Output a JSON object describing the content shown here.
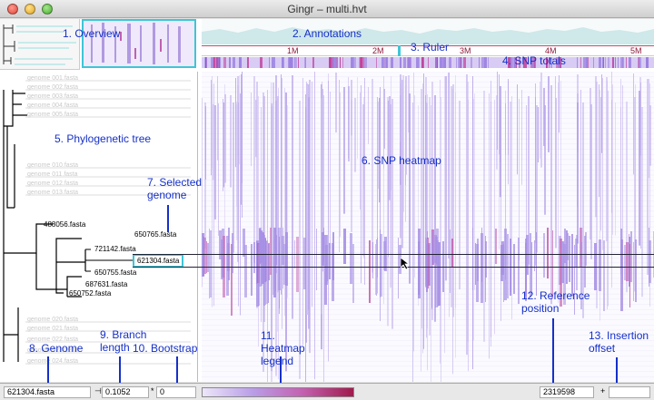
{
  "window": {
    "title": "Gingr – multi.hvt"
  },
  "ruler": {
    "ticks": [
      "1M",
      "2M",
      "3M",
      "4M",
      "5M"
    ]
  },
  "tree": {
    "genomes": [
      {
        "name": "488056.fasta"
      },
      {
        "name": "650765.fasta"
      },
      {
        "name": "721142.fasta"
      },
      {
        "name": "621304.fasta",
        "selected": true
      },
      {
        "name": "650755.fasta"
      },
      {
        "name": "687631.fasta"
      },
      {
        "name": "650752.fasta"
      }
    ]
  },
  "annotations_overlay": [
    {
      "label": "1. Overview"
    },
    {
      "label": "2. Annotations"
    },
    {
      "label": "3. Ruler"
    },
    {
      "label": "4. SNP totals"
    },
    {
      "label": "5. Phylogenetic tree"
    },
    {
      "label": "6. SNP heatmap"
    },
    {
      "label": "7. Selected genome"
    },
    {
      "label": "8. Genome"
    },
    {
      "label": "9. Branch length"
    },
    {
      "label": "10. Bootstrap"
    },
    {
      "label": "11. Heatmap legend"
    },
    {
      "label": "12. Reference position"
    },
    {
      "label": "13. Insertion offset"
    }
  ],
  "status": {
    "genome": "621304.fasta",
    "branch_icon": "⊣",
    "branch_length": "0.1052",
    "bootstrap_icon": "*",
    "bootstrap": "0",
    "reference_position": "2319598",
    "insertion_icon": "+",
    "insertion_offset": ""
  },
  "colors": {
    "accent": "#3ec6d6",
    "annotation_text": "#1530c8",
    "heat_low": "#ece6fa",
    "heat_mid": "#b99de8",
    "heat_high": "#a01a4c"
  }
}
